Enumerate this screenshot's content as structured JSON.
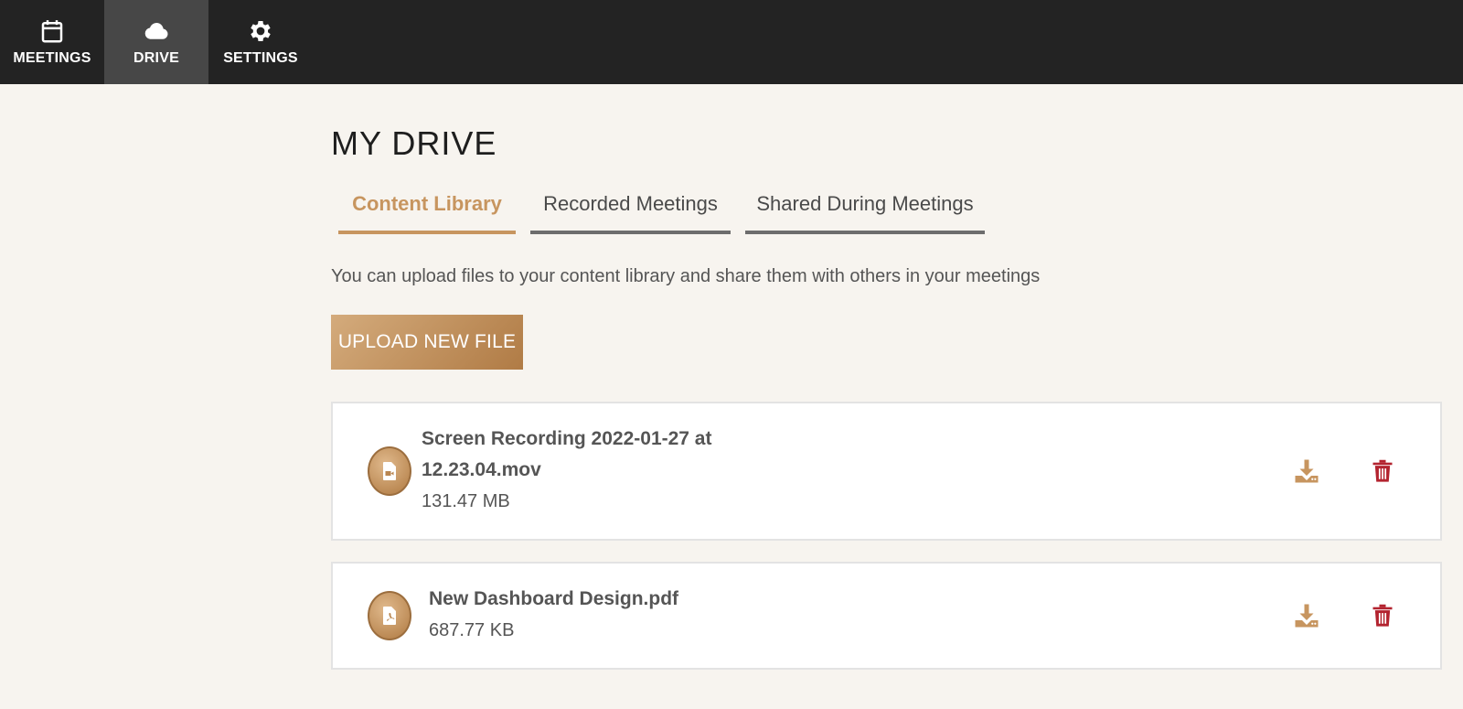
{
  "nav": {
    "items": [
      {
        "label": "MEETINGS",
        "icon": "calendar-icon"
      },
      {
        "label": "DRIVE",
        "icon": "cloud-icon",
        "active": true
      },
      {
        "label": "SETTINGS",
        "icon": "gear-icon"
      }
    ]
  },
  "page": {
    "title": "MY DRIVE",
    "description": "You can upload files to your content library and share them with others in your meetings"
  },
  "tabs": [
    {
      "label": "Content Library",
      "active": true
    },
    {
      "label": "Recorded Meetings"
    },
    {
      "label": "Shared During Meetings"
    }
  ],
  "upload_button": {
    "label": "UPLOAD NEW FILE"
  },
  "files": [
    {
      "name": "Screen Recording 2022-01-27 at 12.23.04.mov",
      "size": "131.47 MB",
      "icon": "video-file-icon"
    },
    {
      "name": "New Dashboard Design.pdf",
      "size": "687.77 KB",
      "icon": "pdf-file-icon"
    }
  ],
  "colors": {
    "accent": "#c7955f",
    "nav_bg": "#232323",
    "nav_active": "#474747",
    "delete": "#b3232f",
    "download": "#c7955f",
    "page_bg": "#f7f4ef"
  }
}
